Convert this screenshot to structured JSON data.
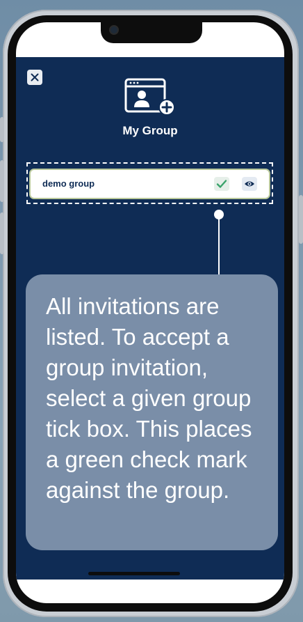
{
  "screen": {
    "title": "My Group",
    "close_icon": "close-icon",
    "header_icon": "add-user-window-icon"
  },
  "invitations": [
    {
      "name": "demo group",
      "accepted": true
    }
  ],
  "row_actions": {
    "accept_icon": "check-icon",
    "view_icon": "eye-icon"
  },
  "callout": {
    "text": "All invitations are listed. To accept a group invitation, select a given group tick box. This places a green check mark against the group."
  },
  "colors": {
    "app_background": "#0f2c55",
    "callout_background": "#7a8ea8",
    "check_green": "#3aa36b"
  }
}
